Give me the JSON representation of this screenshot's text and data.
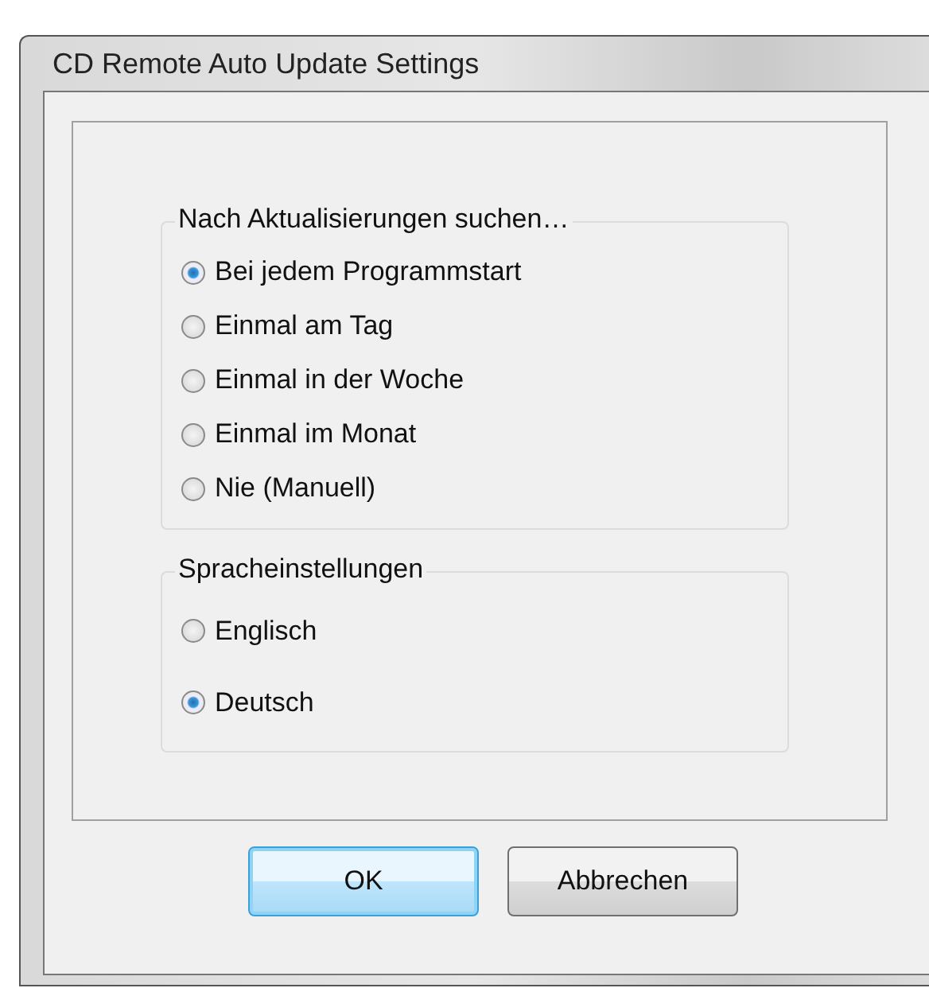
{
  "window": {
    "title": "CD Remote Auto Update Settings"
  },
  "groups": [
    {
      "title": "Nach Aktualisierungen suchen…",
      "options": [
        {
          "label": "Bei jedem Programmstart",
          "selected": true
        },
        {
          "label": "Einmal am Tag",
          "selected": false
        },
        {
          "label": "Einmal in der Woche",
          "selected": false
        },
        {
          "label": "Einmal im Monat",
          "selected": false
        },
        {
          "label": "Nie (Manuell)",
          "selected": false
        }
      ]
    },
    {
      "title": "Spracheinstellungen",
      "options": [
        {
          "label": "Englisch",
          "selected": false
        },
        {
          "label": "Deutsch",
          "selected": true
        }
      ]
    }
  ],
  "buttons": [
    {
      "label": "OK",
      "default": true
    },
    {
      "label": "Abbrechen",
      "default": false
    }
  ]
}
